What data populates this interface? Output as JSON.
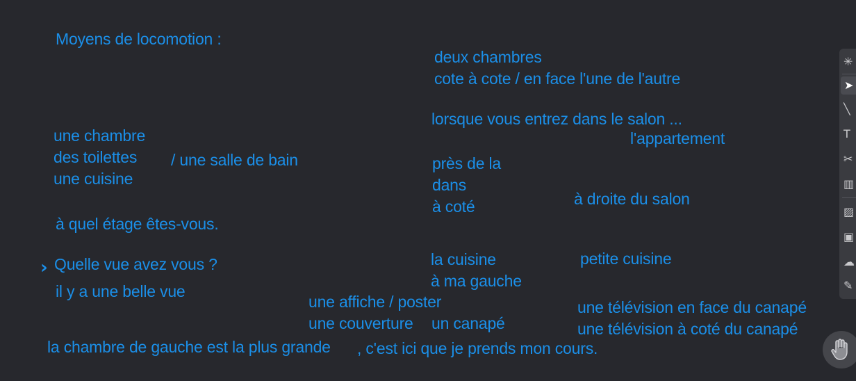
{
  "notes": {
    "n1": "Moyens de locomotion :",
    "n2": "deux chambres",
    "n3": "cote à cote / en face l'une de l'autre",
    "n4": "lorsque vous entrez dans le salon ...",
    "n5": "l'appartement",
    "n6": "une chambre",
    "n7": "des toilettes",
    "n8": "/ une salle de bain",
    "n9": "une cuisine",
    "n10": "près de la",
    "n11": "dans",
    "n12": "à coté",
    "n13": "à droite du salon",
    "n14": "à quel étage êtes-vous.",
    "n15": "Quelle vue avez vous ?",
    "n16": "il y a une belle vue",
    "n17": "la cuisine",
    "n18": "petite cuisine",
    "n19": "à ma gauche",
    "n20": "une affiche / poster",
    "n21": "une télévision en face du canapé",
    "n22": "une couverture",
    "n23": "un canapé",
    "n24": "une télévision à coté du canapé",
    "n25": "la chambre de gauche est la plus grande",
    "n26": ", c'est ici que je prends mon cours."
  },
  "toolbar": {
    "tools": [
      "laser-pointer-icon",
      "select-cursor-icon",
      "pen-icon",
      "text-icon",
      "scissors-icon",
      "trash-icon",
      "image-icon",
      "shape-icon",
      "cloud-save-icon",
      "color-picker-icon"
    ]
  },
  "hand_button": {
    "icon": "raise-hand-icon"
  },
  "colors": {
    "background": "#27282d",
    "ink": "#1b8fe8",
    "toolbar": "#3a3b40"
  }
}
